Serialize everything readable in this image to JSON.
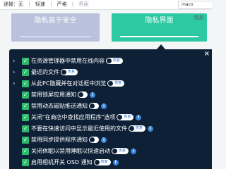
{
  "topbar": {
    "items": [
      "迷操：无",
      "轻速",
      "严格",
      "界面"
    ],
    "search_value": "maco"
  },
  "cards": [
    {
      "label": "隐私高于安全",
      "active": false
    },
    {
      "label": "隐私界面",
      "active": true,
      "corner": "图册"
    }
  ],
  "panel": {
    "close_glyph": "×",
    "rows": [
      {
        "text": "在资源管理器中禁用在线内容",
        "has_chevron": true,
        "toggle_label": "恢复",
        "info": false
      },
      {
        "text": "最近的文件",
        "has_chevron": true,
        "toggle_label": "恢复",
        "info": false
      },
      {
        "text": "从此PC隐藏并在对话框中浏览",
        "has_chevron": true,
        "toggle_label": "恢复",
        "info": false
      },
      {
        "text": "禁用锁屏应用通知",
        "has_chevron": false,
        "toggle_label": "",
        "info": true
      },
      {
        "text": "禁用动态磁贴推送通知",
        "has_chevron": false,
        "toggle_label": "",
        "info": true
      },
      {
        "text": "关闭\"在商店中查找应用程序\"选项",
        "has_chevron": false,
        "toggle_label": "恢复",
        "info": true
      },
      {
        "text": "不要在快速访问中显示最近使用的文件",
        "has_chevron": false,
        "toggle_label": "恢复",
        "info": true
      },
      {
        "text": "禁用同步提供程序通知",
        "has_chevron": false,
        "toggle_label": "",
        "info": true
      },
      {
        "text": "关闭休眠以禁用睡眠以快速启动",
        "has_chevron": false,
        "toggle_label": "恢复",
        "info": true
      },
      {
        "text": "启用相机开关 OSD 通知",
        "has_chevron": false,
        "toggle_label": "恢复",
        "info": true
      }
    ]
  }
}
